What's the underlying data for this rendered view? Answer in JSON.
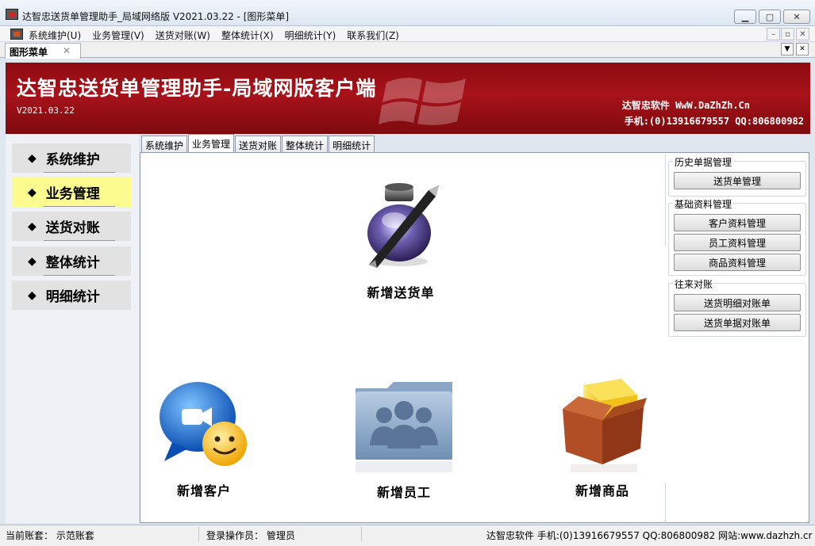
{
  "window": {
    "title": "达智忠送货单管理助手_局域网络版 V2021.03.22 - [图形菜单]"
  },
  "menubar": {
    "items": [
      "系统维护(U)",
      "业务管理(V)",
      "送货对账(W)",
      "整体统计(X)",
      "明细统计(Y)",
      "联系我们(Z)"
    ]
  },
  "doc_tab": {
    "label": "图形菜单",
    "close": "✕"
  },
  "banner": {
    "title": "达智忠送货单管理助手-局域网版客户端",
    "version": "V2021.03.22",
    "company": "达智忠软件 WwW.DaZhZh.Cn",
    "phone": "手机:(0)13916679557 QQ:806800982"
  },
  "nav": {
    "items": [
      {
        "label": "系统维护",
        "active": false
      },
      {
        "label": "业务管理",
        "active": true
      },
      {
        "label": "送货对账",
        "active": false
      },
      {
        "label": "整体统计",
        "active": false
      },
      {
        "label": "明细统计",
        "active": false
      }
    ],
    "bullet": "◆"
  },
  "content_tabs": {
    "items": [
      "系统维护",
      "业务管理",
      "送货对账",
      "整体统计",
      "明细统计"
    ],
    "active_index": 1
  },
  "tiles": {
    "new_delivery": "新增送货单",
    "new_customer": "新增客户",
    "new_employee": "新增员工",
    "new_product": "新增商品"
  },
  "right_panel": {
    "history": {
      "title": "历史单据管理",
      "buttons": [
        "送货单管理"
      ]
    },
    "basic": {
      "title": "基础资料管理",
      "buttons": [
        "客户资料管理",
        "员工资料管理",
        "商品资料管理"
      ]
    },
    "accounts": {
      "title": "往来对账",
      "buttons": [
        "送货明细对账单",
        "送货单据对账单"
      ]
    }
  },
  "status": {
    "account": "当前账套： 示范账套",
    "operator": "登录操作员： 管理员",
    "contact": "达智忠软件 手机:(0)13916679557 QQ:806800982  网站:www.dazhzh.cr"
  },
  "colors": {
    "banner": "#a8131a",
    "active_nav": "#fbfb8f"
  }
}
